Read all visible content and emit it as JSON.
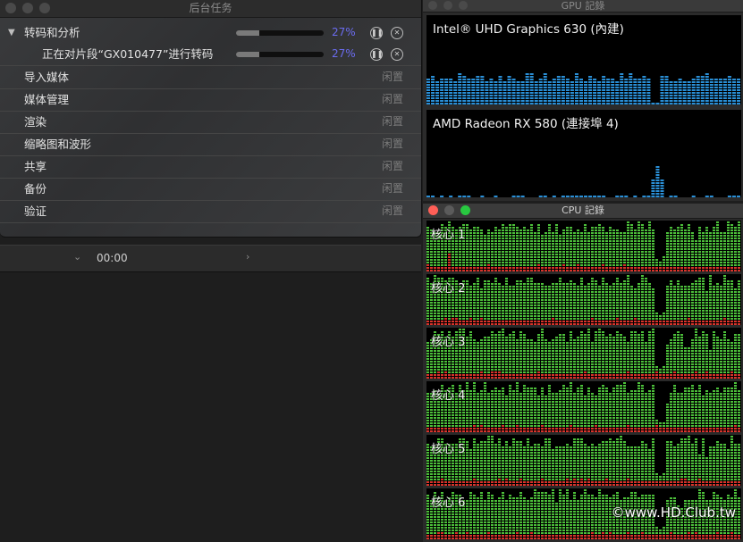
{
  "bg_tasks": {
    "title": "后台任务",
    "group": {
      "label": "转码和分析",
      "percent": "27%",
      "progress": 0.27
    },
    "job": {
      "label": "正在对片段“GX010477”进行转码",
      "percent": "27%",
      "progress": 0.27
    },
    "rows": [
      {
        "label": "导入媒体",
        "status": "闲置"
      },
      {
        "label": "媒体管理",
        "status": "闲置"
      },
      {
        "label": "渲染",
        "status": "闲置"
      },
      {
        "label": "缩略图和波形",
        "status": "闲置"
      },
      {
        "label": "共享",
        "status": "闲置"
      },
      {
        "label": "备份",
        "status": "闲置"
      },
      {
        "label": "验证",
        "status": "闲置"
      }
    ]
  },
  "timeline": {
    "timecode": "00:00"
  },
  "gpu_window": {
    "title": "GPU 記錄",
    "gpus": [
      {
        "name": "Intel® UHD Graphics 630 (內建)",
        "bar_color": "#2a8fd6"
      },
      {
        "name": "AMD Radeon RX 580 (連接埠 4)",
        "bar_color": "#2a8fd6"
      }
    ]
  },
  "cpu_window": {
    "title": "CPU 記錄",
    "colors": {
      "user": "#4cbf3a",
      "system": "#d8332b"
    },
    "cores": [
      {
        "label": "核心 1"
      },
      {
        "label": "核心 2"
      },
      {
        "label": "核心 3"
      },
      {
        "label": "核心 4"
      },
      {
        "label": "核心 5"
      },
      {
        "label": "核心 6"
      }
    ]
  },
  "watermark": "©www.HD.Club.tw"
}
